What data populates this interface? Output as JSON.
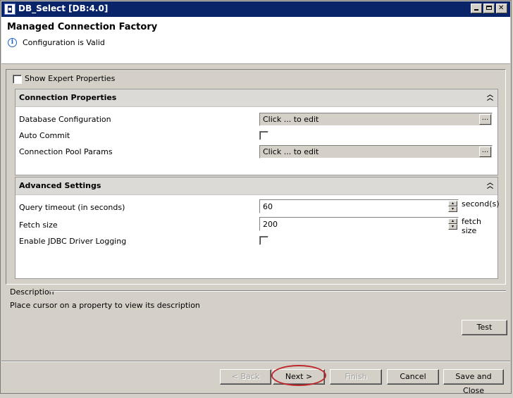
{
  "window": {
    "title": "DB_Select [DB:4.0]"
  },
  "header": {
    "title": "Managed Connection Factory",
    "status": "Configuration is Valid"
  },
  "expert": {
    "label": "Show Expert Properties",
    "checked": false
  },
  "connection_properties": {
    "title": "Connection Properties",
    "database_configuration": {
      "label": "Database Configuration",
      "value": "Click ... to edit",
      "button": "..."
    },
    "auto_commit": {
      "label": "Auto Commit",
      "checked": false
    },
    "connection_pool_params": {
      "label": "Connection Pool Params",
      "value": "Click ... to edit",
      "button": "..."
    }
  },
  "advanced_settings": {
    "title": "Advanced Settings",
    "query_timeout": {
      "label": "Query timeout (in seconds)",
      "value": "60",
      "unit": "second(s)"
    },
    "fetch_size": {
      "label": "Fetch size",
      "value": "200",
      "unit": "fetch size"
    },
    "jdbc_logging": {
      "label": "Enable JDBC Driver Logging",
      "checked": false
    }
  },
  "description": {
    "title": "Description",
    "text": "Place cursor on a property to view its description"
  },
  "buttons": {
    "test": "Test",
    "back": "< Back",
    "next": "Next >",
    "finish": "Finish",
    "cancel": "Cancel",
    "save_close": "Save and Close"
  },
  "colors": {
    "titlebar": "#0a246a",
    "highlight": "#c0282c",
    "info": "#1c60c0"
  }
}
